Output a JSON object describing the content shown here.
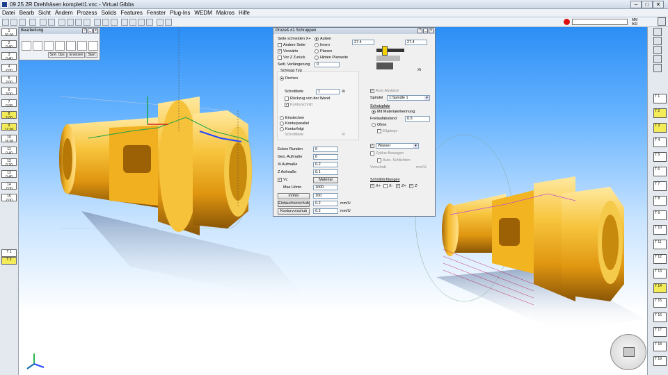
{
  "window": {
    "title": "09 25 2R Drehfräsen komplett1.vnc - Virtual Gibbs",
    "controls": [
      "–",
      "□",
      "✕"
    ]
  },
  "menu": [
    "Datei",
    "Bearb",
    "Sicht",
    "Ändern",
    "Prozess",
    "Solids",
    "Features",
    "Fenster",
    "Plug-Ins",
    "WEDM",
    "Makros",
    "Hilfe"
  ],
  "status": {
    "line1": "MM",
    "line2": "ASI",
    "tool_label": "TOOL"
  },
  "left_tools": [
    {
      "n": "1",
      "v": "30.00"
    },
    {
      "n": "2",
      "v": "0.40"
    },
    {
      "n": "3",
      "v": "0.40"
    },
    {
      "n": "4",
      "v": "2.00"
    },
    {
      "n": "5",
      "v": "2.00"
    },
    {
      "n": "6",
      "v": "3.00"
    },
    {
      "n": "7",
      "v": "0.08"
    },
    {
      "n": "8",
      "v": "2.00"
    },
    {
      "n": "9",
      "v": "12.00"
    },
    {
      "n": "10",
      "v": "16.00"
    },
    {
      "n": "11",
      "v": "0.40"
    },
    {
      "n": "12",
      "v": "0.20"
    },
    {
      "n": "13",
      "v": "0.40"
    },
    {
      "n": "14",
      "v": "2.00"
    },
    {
      "n": "15",
      "v": "2.00"
    }
  ],
  "left_lower": [
    "T 1",
    "T 2"
  ],
  "bearbeitung": {
    "title": "Bearbeitung",
    "buttons": [
      "Sort. Ops",
      "Ersetzen",
      "Start"
    ]
  },
  "dialog": {
    "title": "Prozeß #1 Schruppen",
    "seite_schneiden": "Seite schneiden X+",
    "andere_seite": "Andere Seite",
    "vorwarts": "Vorwärts",
    "vor_z_zuruck": "Vor Z Zurück",
    "aussen": "Außen",
    "innen": "Innen",
    "planen": "Planen",
    "hinten_planseite": "Hinten Planseite",
    "seitl_verl": "Seitl. Verlängerung",
    "seitl_verl_val": "0",
    "schrupp_typ": "Schrupp Typ",
    "drehen": "Drehen",
    "schnitttiefe": "Schnitttiefe",
    "schnitttiefe_val": "1",
    "xi_unit": "Xi",
    "ruckzug": "Rückzug von der Wand",
    "konturschnitt": "Konturschnitt",
    "einstechen": "Einstechen",
    "kontur_parallel": "Konturparallel",
    "konturfolgt": "Konturfolgt",
    "schnitttiefe2": "Schnitttiefe",
    "xi2": "Xi",
    "ecken_runden": "Ecken Runden",
    "ecken_val": "0",
    "geo_aufmasse": "Geo. Aufmaße",
    "geo_val": "0",
    "xi_aufmass": "Xi Aufmaße",
    "xi_aufmass_val": "0.2",
    "z_aufmass": "Z Aufmaße",
    "z_aufmass_val": "0.1",
    "vc": "Vc",
    "material": "Material",
    "max_u_min": "Max U/min",
    "max_u_min_val": "1000",
    "m_min": "m/min",
    "m_min_val": "100",
    "eintauch": "Eintauchvorschub",
    "eintauch_val": "0.2",
    "kontur_vorschub": "Konturvorschub",
    "kontur_val": "0.2",
    "mm_u": "mm/U",
    "mm_u2": "mm/U",
    "field_left": "27.4",
    "field_right": "27.4",
    "auto_abstand": "Auto Abstand",
    "spindel": "Spindel",
    "spindel_val": "1:Spindle 1",
    "schutz": "Schutzplatz",
    "mit_material": "Mit Materialerkennung",
    "freilaufabstand": "Freilaufabstand",
    "freilauf_val": "0.5",
    "ohne": "Ohne",
    "eilgange": "Eilgänge",
    "wasser": "Wasser",
    "zyklus_bew": "Zyklus Bewegen",
    "auto_schlichten": "Auto. Schlichten",
    "vorschub": "Vorschub",
    "mm_u3": "mm/U",
    "schnittrichtungen": "Schnittrichtungen",
    "dir": [
      "X+",
      "X-",
      "Z+",
      "Z-"
    ]
  },
  "right_tools": [
    "T 1",
    "T 2",
    "T 3",
    "T 4",
    "T 5",
    "T 6",
    "T 7",
    "T 8",
    "T 9",
    "T 10",
    "T 11",
    "T 12",
    "T 13",
    "T 14",
    "T 15",
    "T 16",
    "T 17",
    "T 18",
    "T 19"
  ],
  "colors": {
    "gold": "#f2b21c",
    "viewport_top": "#2c8ef5",
    "highlight": "#f3ec58"
  }
}
